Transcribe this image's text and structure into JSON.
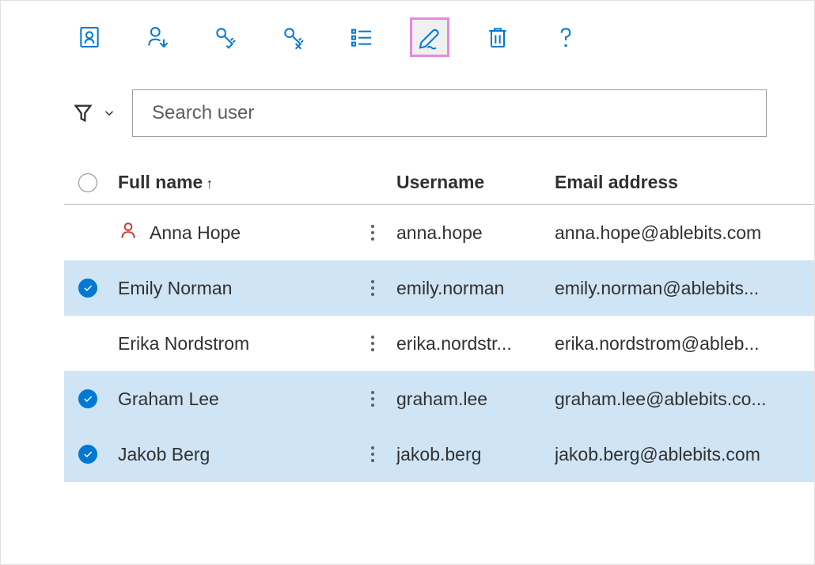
{
  "toolbar": {
    "icons": [
      "add-user",
      "assign-user",
      "reset-password",
      "remove-password",
      "list",
      "edit",
      "delete",
      "help"
    ]
  },
  "search": {
    "placeholder": "Search user"
  },
  "columns": {
    "fullname": "Full name",
    "username": "Username",
    "email": "Email address"
  },
  "users": [
    {
      "selected": false,
      "admin": true,
      "fullname": "Anna Hope",
      "username": "anna.hope",
      "email": "anna.hope@ablebits.com"
    },
    {
      "selected": true,
      "admin": false,
      "fullname": "Emily Norman",
      "username": "emily.norman",
      "email": "emily.norman@ablebits..."
    },
    {
      "selected": false,
      "admin": false,
      "fullname": "Erika Nordstrom",
      "username": "erika.nordstr...",
      "email": "erika.nordstrom@ableb..."
    },
    {
      "selected": true,
      "admin": false,
      "fullname": "Graham Lee",
      "username": "graham.lee",
      "email": "graham.lee@ablebits.co..."
    },
    {
      "selected": true,
      "admin": false,
      "fullname": "Jakob Berg",
      "username": "jakob.berg",
      "email": "jakob.berg@ablebits.com"
    }
  ]
}
